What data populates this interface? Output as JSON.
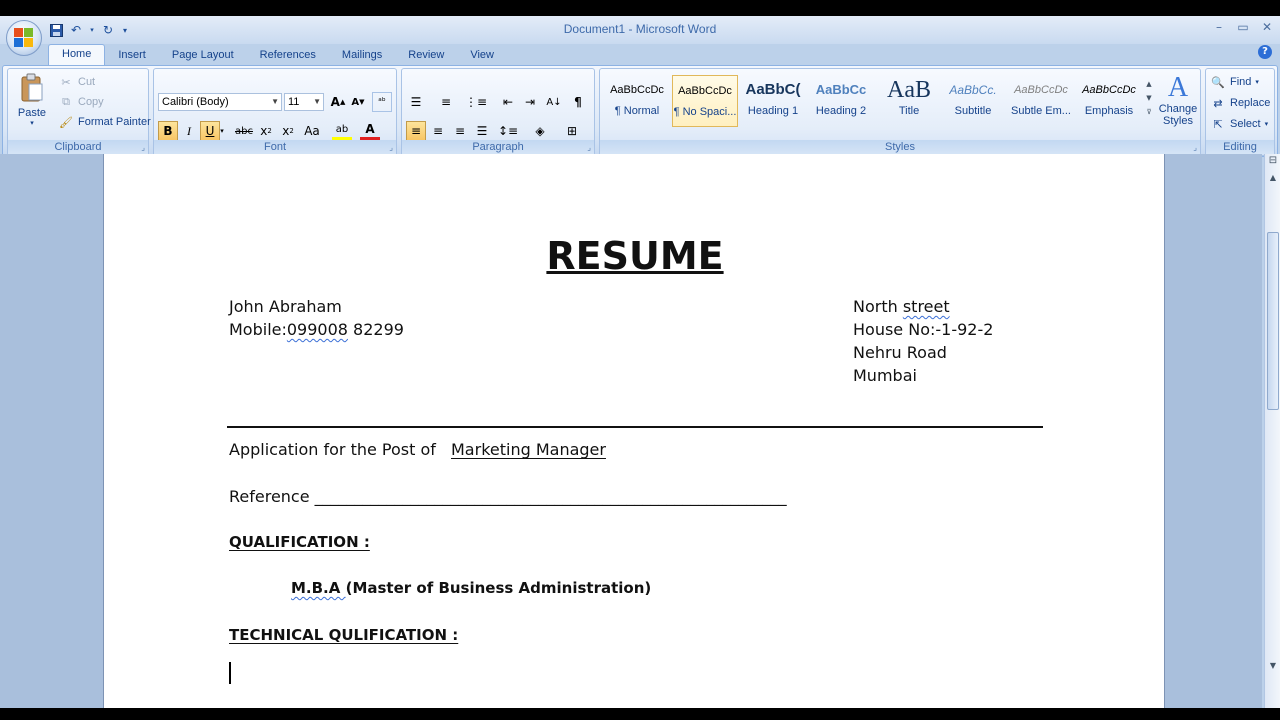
{
  "window": {
    "title": "Document1 - Microsoft Word"
  },
  "tabs": [
    "Home",
    "Insert",
    "Page Layout",
    "References",
    "Mailings",
    "Review",
    "View"
  ],
  "active_tab": "Home",
  "ribbon": {
    "clipboard": {
      "label": "Clipboard",
      "paste": "Paste",
      "cut": "Cut",
      "copy": "Copy",
      "format_painter": "Format Painter"
    },
    "font": {
      "label": "Font",
      "font_name": "Calibri (Body)",
      "font_size": "11"
    },
    "paragraph": {
      "label": "Paragraph"
    },
    "styles": {
      "label": "Styles",
      "items": [
        {
          "sample": "AaBbCcDc",
          "name": "¶ Normal"
        },
        {
          "sample": "AaBbCcDc",
          "name": "¶ No Spaci..."
        },
        {
          "sample": "AaBbC(",
          "name": "Heading 1"
        },
        {
          "sample": "AaBbCc",
          "name": "Heading 2"
        },
        {
          "sample": "AaB",
          "name": "Title"
        },
        {
          "sample": "AaBbCc.",
          "name": "Subtitle"
        },
        {
          "sample": "AaBbCcDc",
          "name": "Subtle Em..."
        },
        {
          "sample": "AaBbCcDc",
          "name": "Emphasis"
        }
      ],
      "change_styles": "Change Styles"
    },
    "editing": {
      "label": "Editing",
      "find": "Find",
      "replace": "Replace",
      "select": "Select"
    }
  },
  "document": {
    "title": "RESUME",
    "name": "John Abraham",
    "mobile_prefix": "Mobile:",
    "mobile_num1": "099008",
    "mobile_num2": " 82299",
    "address": {
      "line1_a": "North ",
      "line1_b": "street",
      "line2": "House No:-1-92-2",
      "line3": "Nehru Road",
      "line4": "Mumbai"
    },
    "application_label": "Application for the Post of",
    "application_value": "Marketing Manager",
    "reference_label": "Reference",
    "reference_line": "___________________________________________________________",
    "qualification_heading": "QUALIFICATION  :",
    "qualification_item_a": "M.B.A ",
    "qualification_item_b": " (Master of Business Administration)",
    "technical_heading": "TECHNICAL QULIFICATION  :"
  },
  "colors": {
    "ribbon_text": "#15428b",
    "squiggle": "#3b6fd6",
    "selected_style": "#fff0c0"
  }
}
